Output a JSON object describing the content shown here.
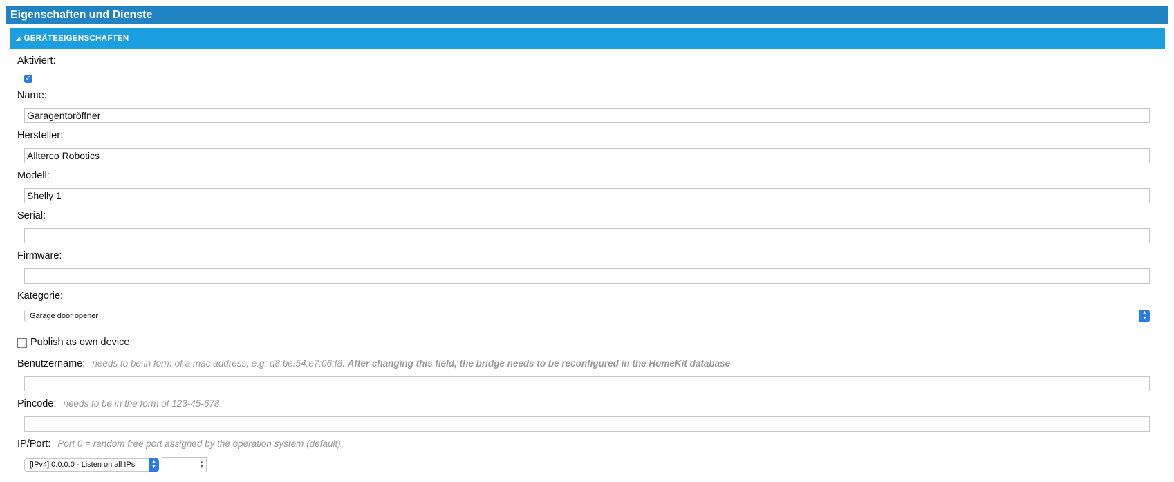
{
  "header": {
    "title": "Eigenschaften und Dienste"
  },
  "section": {
    "title": "GERÄTEEIGENSCHAFTEN",
    "collapse_icon": "triangle-down-icon"
  },
  "fields": {
    "aktiviert": {
      "label": "Aktiviert:",
      "checked": true
    },
    "name": {
      "label": "Name:",
      "value": "Garagentoröffner"
    },
    "hersteller": {
      "label": "Hersteller:",
      "value": "Allterco Robotics"
    },
    "modell": {
      "label": "Modell:",
      "value": "Shelly 1"
    },
    "serial": {
      "label": "Serial:",
      "value": ""
    },
    "firmware": {
      "label": "Firmware:",
      "value": ""
    },
    "kategorie": {
      "label": "Kategorie:",
      "selected": "Garage door opener"
    },
    "publish": {
      "label": "Publish as own device",
      "checked": false
    },
    "benutzername": {
      "label": "Benutzername:",
      "hint": "needs to be in form of a mac address, e.g: d8:be:54:e7:06:f8.",
      "hint_bold": "After changing this field, the bridge needs to be reconfigured in the HomeKit database",
      "value": ""
    },
    "pincode": {
      "label": "Pincode:",
      "hint": "needs to be in the form of 123-45-678",
      "value": ""
    },
    "ipport": {
      "label": "IP/Port:",
      "hint": "Port 0 = random free port assigned by the operation system (default)",
      "ip_selected": "[IPv4] 0.0.0.0 - Listen on all IPs",
      "port_value": ""
    }
  },
  "colors": {
    "header": "#1f83c4",
    "section": "#1c9fe0",
    "accent": "#2a7be4",
    "hint": "#999999"
  }
}
